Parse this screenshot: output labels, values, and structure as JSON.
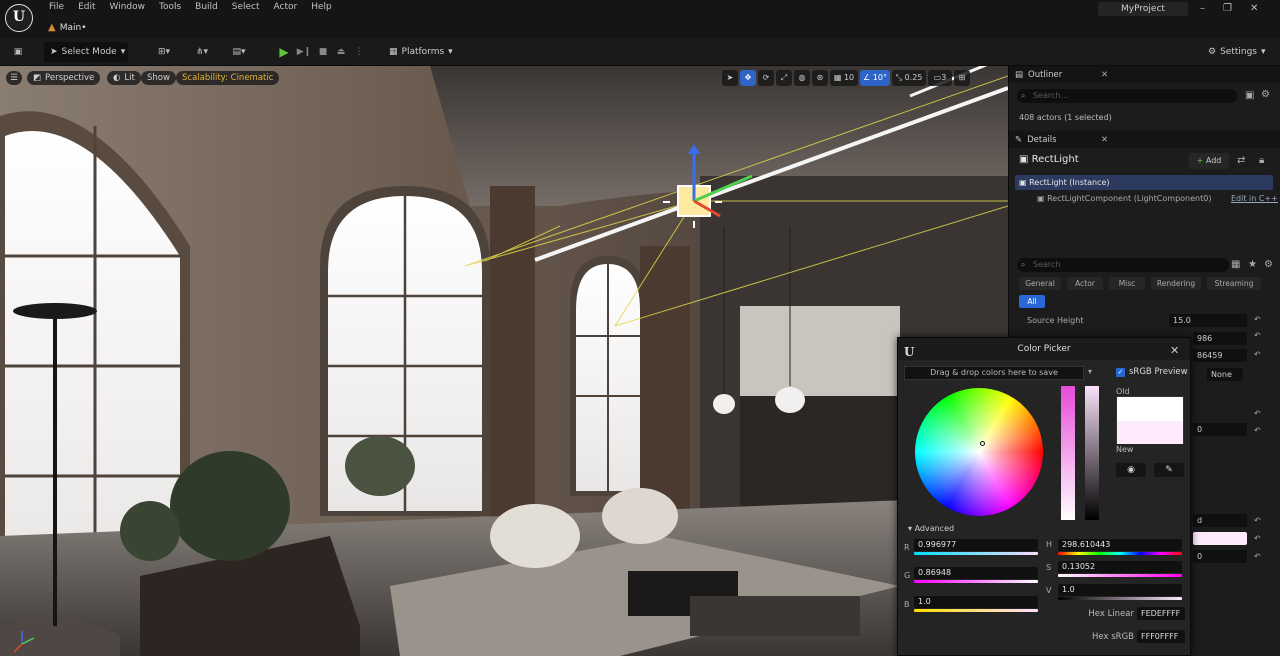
{
  "menu": [
    "File",
    "Edit",
    "Window",
    "Tools",
    "Build",
    "Select",
    "Actor",
    "Help"
  ],
  "tab": {
    "label": "Main•"
  },
  "project": "MyProject",
  "toolbar": {
    "select_mode": "Select Mode",
    "platforms": "Platforms",
    "settings": "Settings"
  },
  "viewport": {
    "perspective": "Perspective",
    "lit": "Lit",
    "show": "Show",
    "scalability": "Scalability: Cinematic",
    "grid": "10",
    "angle": "10°",
    "scale": "0.25",
    "camera_speed": "3"
  },
  "outliner": {
    "title": "Outliner",
    "search_placeholder": "Search...",
    "status": "408 actors (1 selected)"
  },
  "details": {
    "title": "Details",
    "actor_name": "RectLight",
    "add_label": "Add",
    "instance": "RectLight (Instance)",
    "component": "RectLightComponent (LightComponent0)",
    "edit_cpp": "Edit in C++",
    "search_placeholder": "Search",
    "categories": [
      "General",
      "Actor",
      "Misc",
      "Rendering",
      "Streaming"
    ],
    "all_label": "All",
    "source_height_label": "Source Height",
    "source_height_value": "15.0",
    "partial_values": [
      "986",
      "86459",
      "None",
      "0",
      "d",
      "0"
    ]
  },
  "picker": {
    "title": "Color Picker",
    "drop_text": "Drag & drop colors here to save",
    "srgb_preview": "sRGB Preview",
    "old_label": "Old",
    "new_label": "New",
    "advanced": "Advanced",
    "r": "0.996977",
    "g": "0.86948",
    "b": "1.0",
    "h": "298.610443",
    "s": "0.13052",
    "v": "1.0",
    "hex_linear_label": "Hex Linear",
    "hex_linear": "FEDEFFFF",
    "hex_srgb_label": "Hex sRGB",
    "hex_srgb": "FFF0FFFF"
  }
}
